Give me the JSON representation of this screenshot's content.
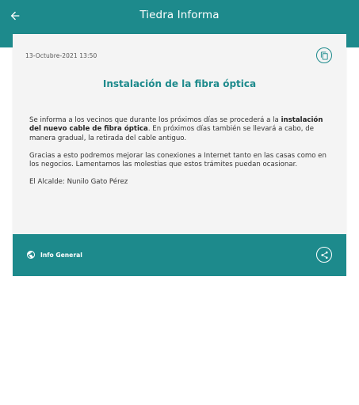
{
  "header": {
    "title": "Tiedra Informa",
    "back_icon": "arrow-left-icon"
  },
  "post": {
    "date": "13-Octubre-2021 13:50",
    "copy_icon": "copy-icon",
    "title": "Instalación de la fibra óptica",
    "paragraph1_pre": "Se informa a los vecinos que durante los próximos días se procederá a la ",
    "paragraph1_bold": "instalación del nuevo cable de fibra óptica",
    "paragraph1_post": ". En próximos días también se llevará a cabo, de manera gradual, la retirada del cable antiguo.",
    "paragraph2": "Gracias a esto podremos mejorar las conexiones a Internet tanto en las casas como en los negocios. Lamentamos las molestias que estos trámites puedan ocasionar.",
    "signature": "El Alcalde: Nunilo Gato Pérez",
    "category_label": "Info General",
    "category_icon": "globe-icon",
    "share_icon": "share-icon"
  },
  "colors": {
    "primary": "#1d8a8c",
    "card_background": "#f4f4f4"
  }
}
